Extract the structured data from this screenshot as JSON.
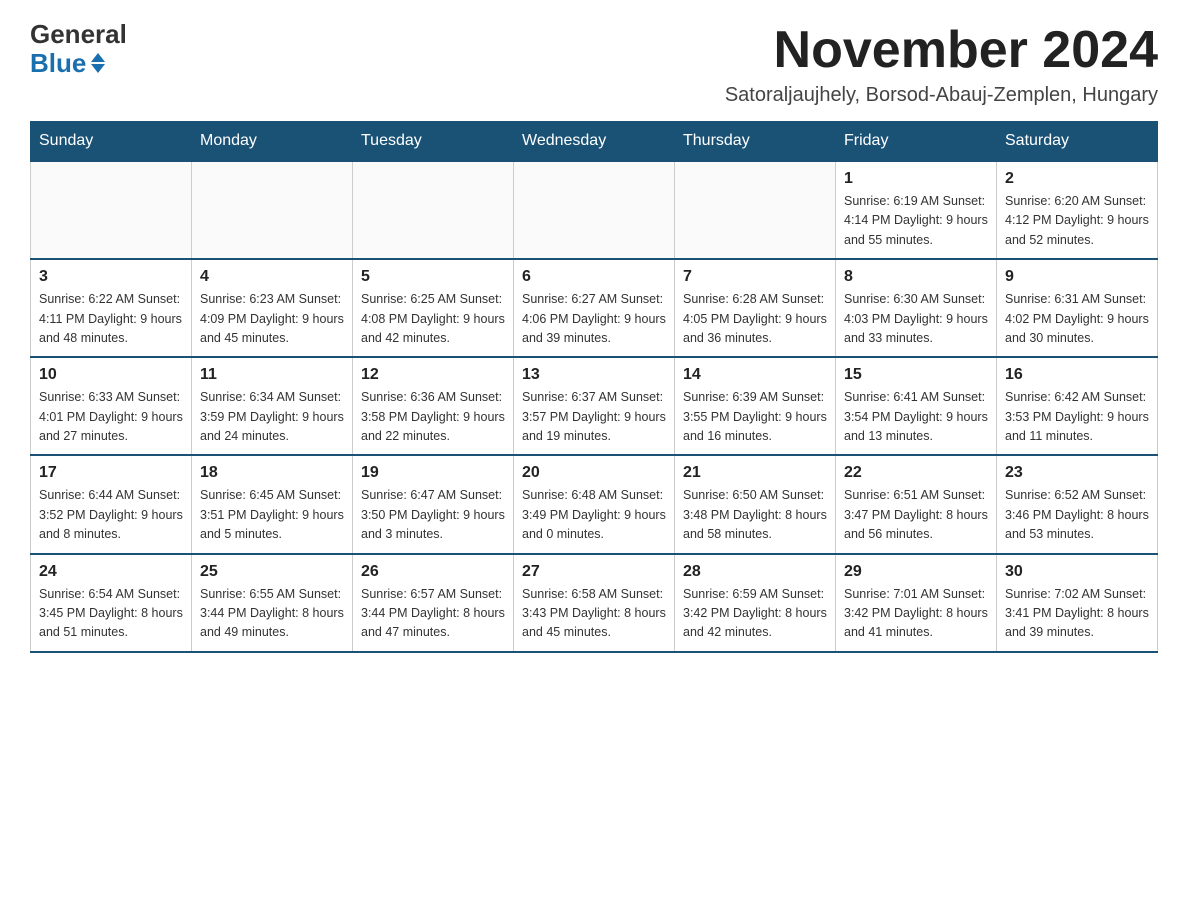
{
  "logo": {
    "line1": "General",
    "line2": "Blue"
  },
  "title": "November 2024",
  "subtitle": "Satoraljaujhely, Borsod-Abauj-Zemplen, Hungary",
  "days_of_week": [
    "Sunday",
    "Monday",
    "Tuesday",
    "Wednesday",
    "Thursday",
    "Friday",
    "Saturday"
  ],
  "weeks": [
    [
      {
        "day": "",
        "info": ""
      },
      {
        "day": "",
        "info": ""
      },
      {
        "day": "",
        "info": ""
      },
      {
        "day": "",
        "info": ""
      },
      {
        "day": "",
        "info": ""
      },
      {
        "day": "1",
        "info": "Sunrise: 6:19 AM\nSunset: 4:14 PM\nDaylight: 9 hours and 55 minutes."
      },
      {
        "day": "2",
        "info": "Sunrise: 6:20 AM\nSunset: 4:12 PM\nDaylight: 9 hours and 52 minutes."
      }
    ],
    [
      {
        "day": "3",
        "info": "Sunrise: 6:22 AM\nSunset: 4:11 PM\nDaylight: 9 hours and 48 minutes."
      },
      {
        "day": "4",
        "info": "Sunrise: 6:23 AM\nSunset: 4:09 PM\nDaylight: 9 hours and 45 minutes."
      },
      {
        "day": "5",
        "info": "Sunrise: 6:25 AM\nSunset: 4:08 PM\nDaylight: 9 hours and 42 minutes."
      },
      {
        "day": "6",
        "info": "Sunrise: 6:27 AM\nSunset: 4:06 PM\nDaylight: 9 hours and 39 minutes."
      },
      {
        "day": "7",
        "info": "Sunrise: 6:28 AM\nSunset: 4:05 PM\nDaylight: 9 hours and 36 minutes."
      },
      {
        "day": "8",
        "info": "Sunrise: 6:30 AM\nSunset: 4:03 PM\nDaylight: 9 hours and 33 minutes."
      },
      {
        "day": "9",
        "info": "Sunrise: 6:31 AM\nSunset: 4:02 PM\nDaylight: 9 hours and 30 minutes."
      }
    ],
    [
      {
        "day": "10",
        "info": "Sunrise: 6:33 AM\nSunset: 4:01 PM\nDaylight: 9 hours and 27 minutes."
      },
      {
        "day": "11",
        "info": "Sunrise: 6:34 AM\nSunset: 3:59 PM\nDaylight: 9 hours and 24 minutes."
      },
      {
        "day": "12",
        "info": "Sunrise: 6:36 AM\nSunset: 3:58 PM\nDaylight: 9 hours and 22 minutes."
      },
      {
        "day": "13",
        "info": "Sunrise: 6:37 AM\nSunset: 3:57 PM\nDaylight: 9 hours and 19 minutes."
      },
      {
        "day": "14",
        "info": "Sunrise: 6:39 AM\nSunset: 3:55 PM\nDaylight: 9 hours and 16 minutes."
      },
      {
        "day": "15",
        "info": "Sunrise: 6:41 AM\nSunset: 3:54 PM\nDaylight: 9 hours and 13 minutes."
      },
      {
        "day": "16",
        "info": "Sunrise: 6:42 AM\nSunset: 3:53 PM\nDaylight: 9 hours and 11 minutes."
      }
    ],
    [
      {
        "day": "17",
        "info": "Sunrise: 6:44 AM\nSunset: 3:52 PM\nDaylight: 9 hours and 8 minutes."
      },
      {
        "day": "18",
        "info": "Sunrise: 6:45 AM\nSunset: 3:51 PM\nDaylight: 9 hours and 5 minutes."
      },
      {
        "day": "19",
        "info": "Sunrise: 6:47 AM\nSunset: 3:50 PM\nDaylight: 9 hours and 3 minutes."
      },
      {
        "day": "20",
        "info": "Sunrise: 6:48 AM\nSunset: 3:49 PM\nDaylight: 9 hours and 0 minutes."
      },
      {
        "day": "21",
        "info": "Sunrise: 6:50 AM\nSunset: 3:48 PM\nDaylight: 8 hours and 58 minutes."
      },
      {
        "day": "22",
        "info": "Sunrise: 6:51 AM\nSunset: 3:47 PM\nDaylight: 8 hours and 56 minutes."
      },
      {
        "day": "23",
        "info": "Sunrise: 6:52 AM\nSunset: 3:46 PM\nDaylight: 8 hours and 53 minutes."
      }
    ],
    [
      {
        "day": "24",
        "info": "Sunrise: 6:54 AM\nSunset: 3:45 PM\nDaylight: 8 hours and 51 minutes."
      },
      {
        "day": "25",
        "info": "Sunrise: 6:55 AM\nSunset: 3:44 PM\nDaylight: 8 hours and 49 minutes."
      },
      {
        "day": "26",
        "info": "Sunrise: 6:57 AM\nSunset: 3:44 PM\nDaylight: 8 hours and 47 minutes."
      },
      {
        "day": "27",
        "info": "Sunrise: 6:58 AM\nSunset: 3:43 PM\nDaylight: 8 hours and 45 minutes."
      },
      {
        "day": "28",
        "info": "Sunrise: 6:59 AM\nSunset: 3:42 PM\nDaylight: 8 hours and 42 minutes."
      },
      {
        "day": "29",
        "info": "Sunrise: 7:01 AM\nSunset: 3:42 PM\nDaylight: 8 hours and 41 minutes."
      },
      {
        "day": "30",
        "info": "Sunrise: 7:02 AM\nSunset: 3:41 PM\nDaylight: 8 hours and 39 minutes."
      }
    ]
  ]
}
